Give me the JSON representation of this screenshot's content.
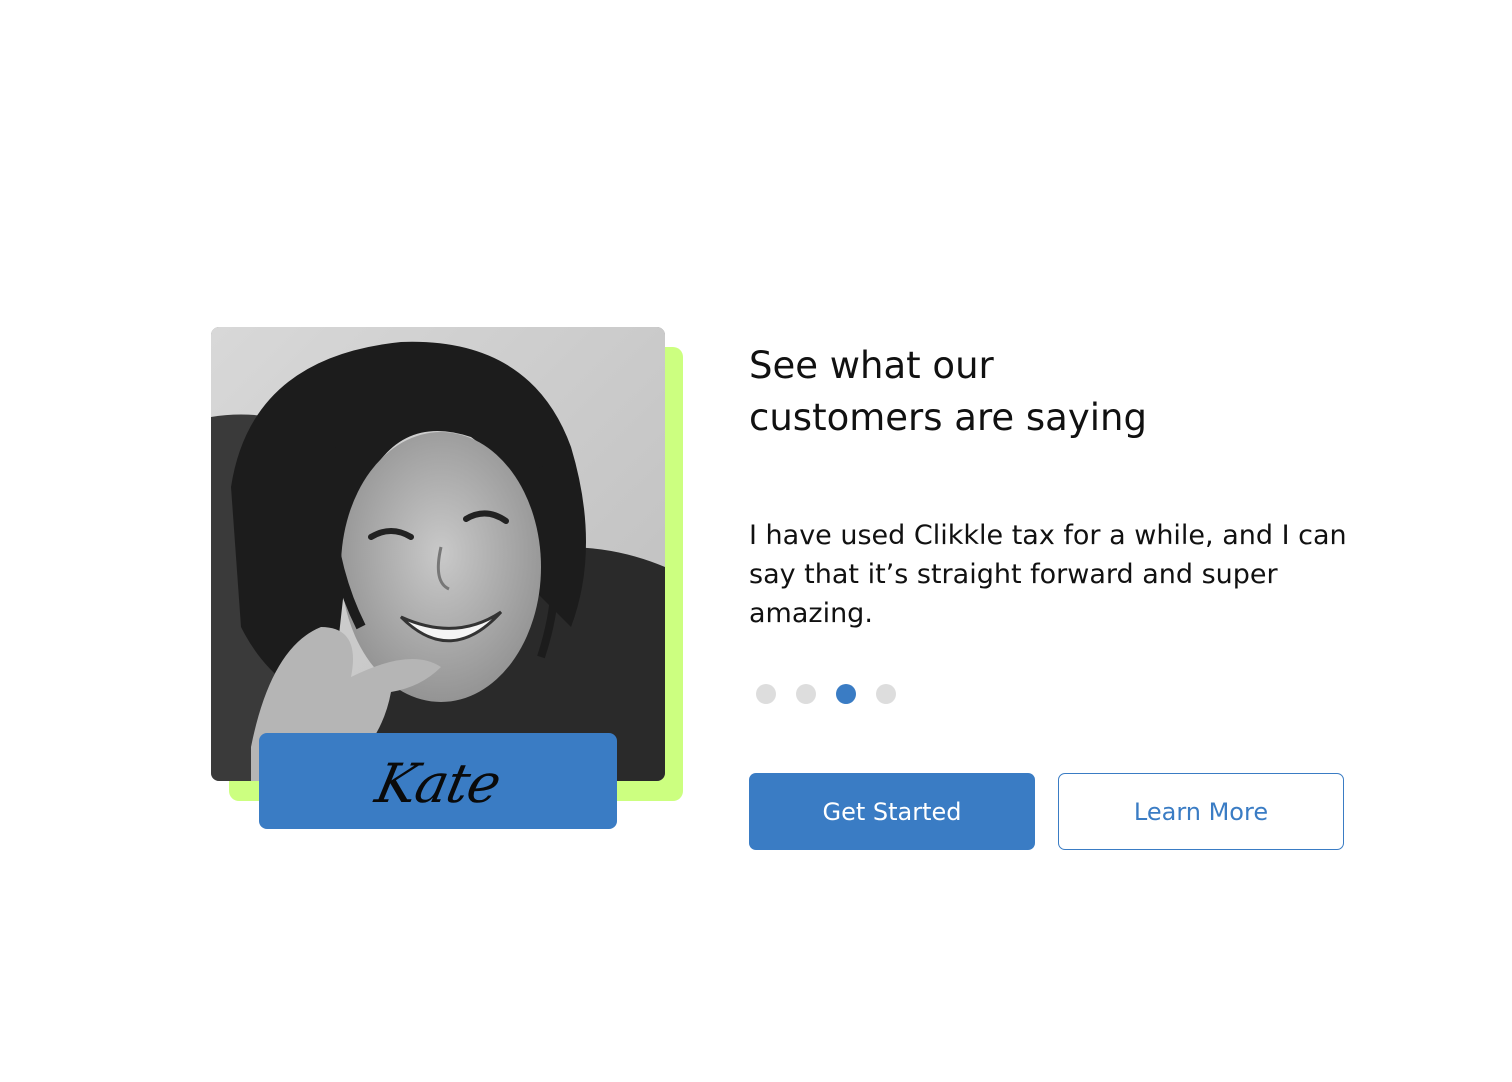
{
  "testimonial": {
    "photo_alt": "Smiling woman, black and white portrait",
    "name": "Kate",
    "heading": [
      "See what our",
      "customers are saying"
    ],
    "quote": [
      "I have used Clikkle tax for a while, and I can",
      "say that it’s straight forward and super",
      "amazing."
    ]
  },
  "carousel": {
    "total": 4,
    "active_index": 2
  },
  "buttons": {
    "primary_label": "Get Started",
    "secondary_label": "Learn More"
  },
  "colors": {
    "accent_green": "#ccff80",
    "brand_blue": "#3a7cc4",
    "dot_inactive": "#dddddd",
    "text": "#111111"
  }
}
